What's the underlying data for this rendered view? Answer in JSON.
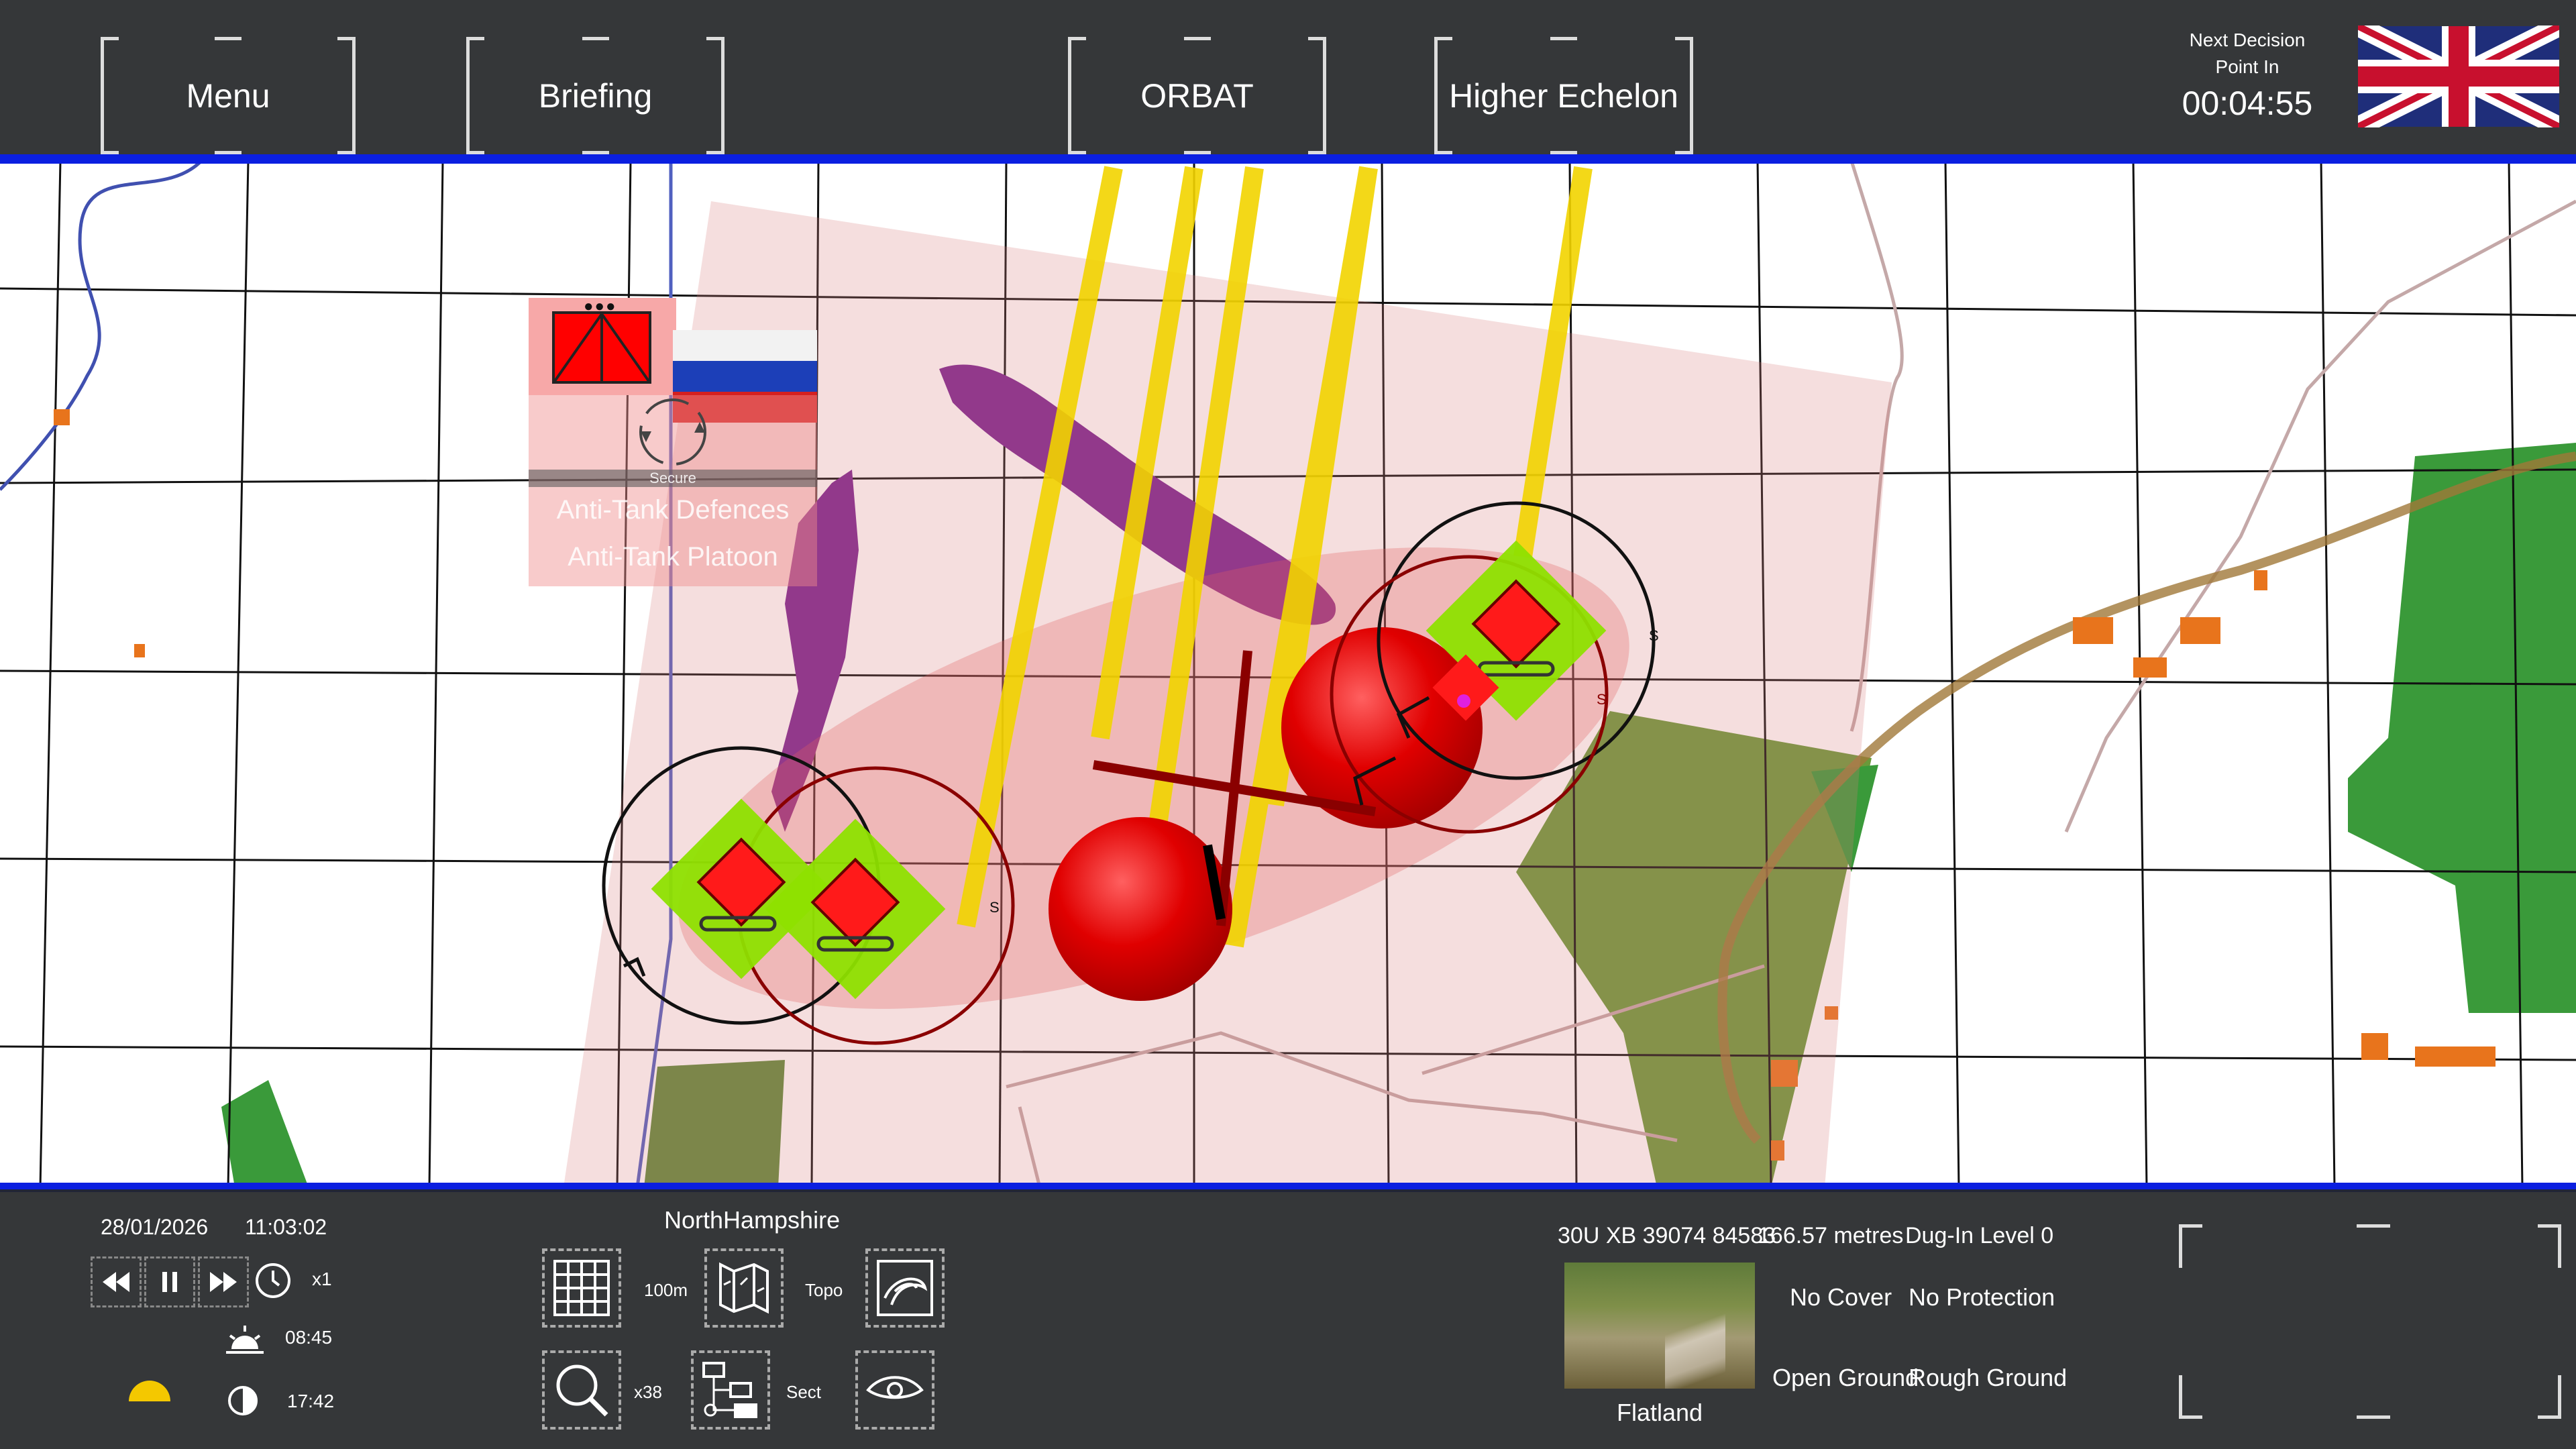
{
  "top_bar": {
    "menu_label": "Menu",
    "briefing_label": "Briefing",
    "orbat_label": "ORBAT",
    "higher_echelon_label": "Higher Echelon",
    "next_decision_line1": "Next Decision",
    "next_decision_line2": "Point In",
    "next_decision_time": "00:04:55",
    "player_flag": "uk-flag-icon"
  },
  "enemy_unit": {
    "flag": "russia-flag-icon",
    "status": "Secure",
    "task": "Anti-Tank Defences",
    "name": "Anti-Tank Platoon",
    "color": "#ff0000"
  },
  "friendly_units": {
    "color": "#8ee000",
    "range_ring_label": "S"
  },
  "bottom_bar": {
    "date": "28/01/2026",
    "time": "11:03:02",
    "speed": "x1",
    "sunrise": "08:45",
    "sunset": "17:42",
    "region": "NorthHampshire",
    "grid_size": "100m",
    "map_type": "Topo",
    "zoom": "x38",
    "sect_label": "Sect",
    "grid_ref": "30U XB 39074 84583",
    "elevation": "166.57 metres",
    "dug_in": "Dug-In Level 0",
    "cover": "No Cover",
    "protection": "No Protection",
    "ground1": "Open Ground",
    "ground2": "Rough Ground",
    "terrain_type": "Flatland"
  },
  "colors": {
    "bar_bg": "#242628",
    "accent_blue": "#0b1fe0",
    "fire_line": "#f2d400",
    "friendly": "#8ee000",
    "enemy": "#ff0000"
  }
}
